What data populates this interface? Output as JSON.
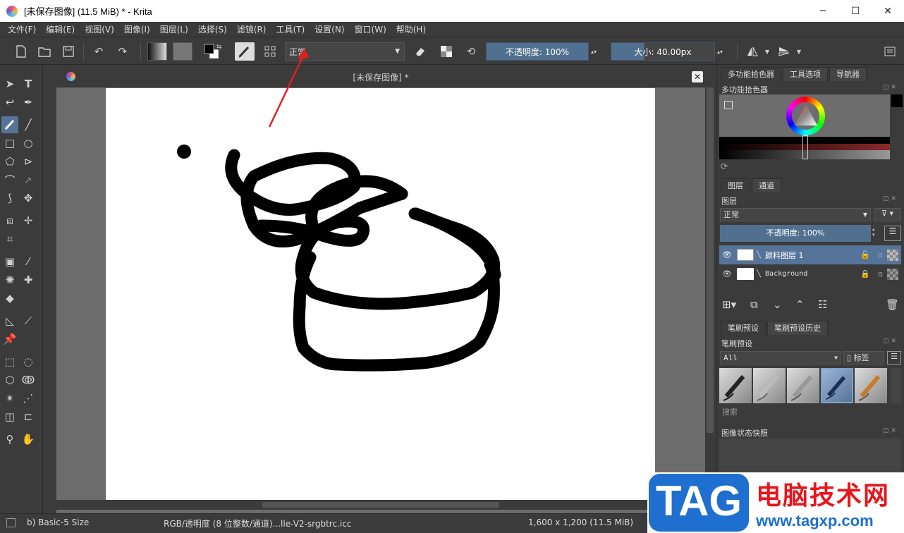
{
  "window": {
    "title": "[未保存图像]  (11.5 MiB)  * - Krita",
    "minimize_glyph": "─",
    "maximize_glyph": "☐",
    "close_glyph": "✕"
  },
  "menu": {
    "items": [
      "文件(F)",
      "编辑(E)",
      "视图(V)",
      "图像(I)",
      "图层(L)",
      "选择(S)",
      "滤镜(R)",
      "工具(T)",
      "设置(N)",
      "窗口(W)",
      "帮助(H)"
    ]
  },
  "toolbar": {
    "blend_mode": "正常",
    "opacity": "不透明度: 100%",
    "size": "大小: 40.00px"
  },
  "document": {
    "tab_title": "[未保存图像]  *"
  },
  "docker": {
    "top_tabs": [
      "多功能拾色器",
      "工具选项",
      "导航器"
    ],
    "color_panel_title": "多功能拾色器",
    "layer_tabs": [
      "图层",
      "通道"
    ],
    "layers_title": "图层",
    "layer_blend": "正常",
    "layer_opacity": "不透明度:  100%",
    "layers": [
      {
        "name": "颜料图层 1",
        "selected": true
      },
      {
        "name": "Background",
        "selected": false
      }
    ],
    "brush_tabs": [
      "笔刷预设",
      "笔刷预设历史"
    ],
    "brush_title": "笔刷预设",
    "brush_filter": "All",
    "brush_tag": "标签",
    "brush_search": "搜索",
    "snapshot_title": "图像状态快照"
  },
  "status": {
    "brush": "b) Basic-5 Size",
    "color_space": "RGB/透明度 (8 位整数/通道)...lle-V2-srgbtrc.icc",
    "dimensions": "1,600 x 1,200 (11.5 MiB)"
  },
  "watermark": {
    "tag": "TAG",
    "site_name": "电脑技术网",
    "url": "www.tagxp.com"
  },
  "colors": {
    "accent": "#56749a",
    "annotation_arrow": "#e02020",
    "watermark_blue": "#1e6fcf",
    "watermark_red": "#e8151b"
  }
}
